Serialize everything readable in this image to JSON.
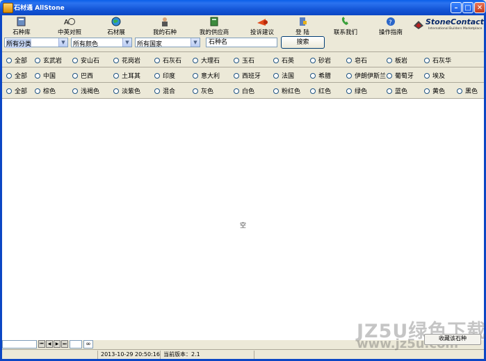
{
  "window": {
    "title": "石材通 AllStone"
  },
  "toolbar": {
    "items": [
      {
        "label": "石种库",
        "icon": "book-icon"
      },
      {
        "label": "中英对照",
        "icon": "translate-icon"
      },
      {
        "label": "石材展",
        "icon": "globe-icon"
      },
      {
        "label": "我的石种",
        "icon": "user-icon"
      },
      {
        "label": "我的供应商",
        "icon": "address-book-icon"
      },
      {
        "label": "投诉建议",
        "icon": "megaphone-icon"
      },
      {
        "label": "登 陆",
        "icon": "login-icon"
      },
      {
        "label": "联系我们",
        "icon": "phone-icon"
      },
      {
        "label": "操作指南",
        "icon": "help-icon"
      }
    ]
  },
  "logo": {
    "text": "StoneContact",
    "sub": "International Builders Marketplace"
  },
  "filters": {
    "category": "所有分类",
    "color": "所有颜色",
    "country": "所有国家",
    "name_input": "石种名",
    "search_button": "搜索"
  },
  "rows": {
    "types": [
      "全部",
      "玄武岩",
      "安山石",
      "花岗岩",
      "石灰石",
      "大理石",
      "玉石",
      "石英",
      "砂岩",
      "皂石",
      "板岩",
      "石灰华"
    ],
    "countries": [
      "全部",
      "中国",
      "巴西",
      "土耳其",
      "印度",
      "意大利",
      "西班牙",
      "法国",
      "希腊",
      "伊朗伊斯兰",
      "葡萄牙",
      "埃及"
    ],
    "colors": [
      "全部",
      "棕色",
      "浅褐色",
      "淡紫色",
      "混合",
      "灰色",
      "白色",
      "粉红色",
      "红色",
      "绿色",
      "蓝色",
      "黄色",
      "黑色"
    ]
  },
  "content": {
    "empty_text": "空"
  },
  "pager": {
    "page_value": "",
    "total_label": "∞"
  },
  "status": {
    "datetime": "2013-10-29 20:50:16",
    "version": "当前版本：2.1"
  },
  "side_button": "收藏该石种",
  "watermark": {
    "line1": "JZ5U绿色下载",
    "line2": "www.jz5u.com"
  },
  "colors": {
    "titlebar": "#0b46c4",
    "accent": "#1557d8"
  }
}
